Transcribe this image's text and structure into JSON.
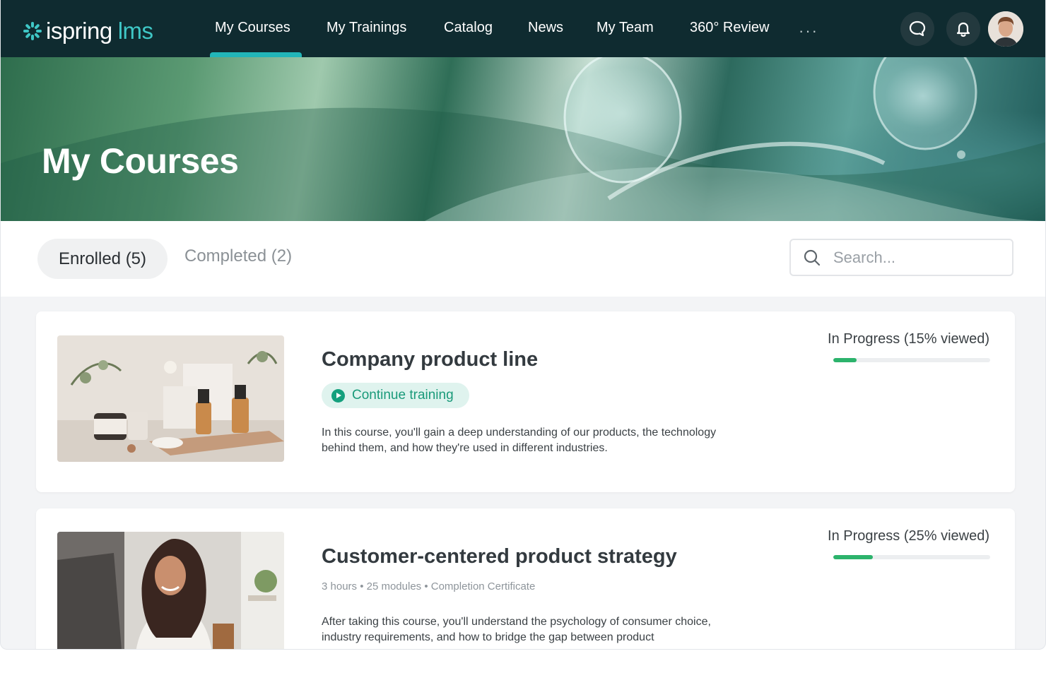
{
  "brand": {
    "name": "ispring",
    "suffix": "lms",
    "accent": "#22b5b8"
  },
  "nav": {
    "items": [
      {
        "label": "My Courses",
        "active": true
      },
      {
        "label": "My Trainings"
      },
      {
        "label": "Catalog"
      },
      {
        "label": "News"
      },
      {
        "label": "My Team"
      },
      {
        "label": "360° Review"
      }
    ],
    "more_label": "···",
    "icons": [
      "chat-icon",
      "bell-icon",
      "user-avatar"
    ]
  },
  "hero": {
    "title": "My Courses"
  },
  "filters": {
    "enrolled_label": "Enrolled (5)",
    "completed_label": "Completed (2)",
    "search_placeholder": "Search..."
  },
  "courses": [
    {
      "title": "Company product line",
      "action_label": "Continue training",
      "description": "In this course, you'll gain a deep understanding of our products, the technology behind them, and how they're used in different industries.",
      "status": "In Progress (15% viewed)",
      "progress": 0.15,
      "image": "skincare-products-photo"
    },
    {
      "title": "Customer-centered product strategy",
      "meta": "3 hours • 25 modules  •  Completion Certificate",
      "description": "After taking this course, you'll understand the psychology of consumer choice, industry requirements, and how to bridge the gap between product",
      "status": "In Progress (25% viewed)",
      "progress": 0.25,
      "image": "woman-at-computer-photo"
    }
  ],
  "colors": {
    "topbar": "#0f2b30",
    "progress": "#2cb36c",
    "continue_bg": "#dff3ee",
    "continue_text": "#1a9a7a"
  }
}
